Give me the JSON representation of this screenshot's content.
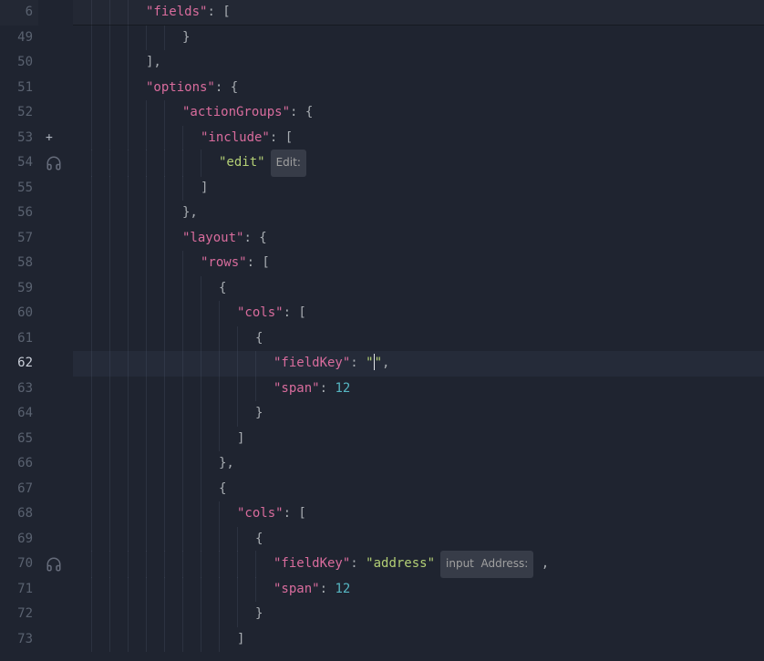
{
  "editor": {
    "sticky": {
      "lineNumber": "6",
      "indent": 4,
      "tokens": [
        {
          "t": "key",
          "v": "\"fields\""
        },
        {
          "t": "punc",
          "v": ": ["
        }
      ]
    },
    "lines": [
      {
        "n": "49",
        "indent": 6,
        "tokens": [
          {
            "t": "punc",
            "v": "}"
          }
        ]
      },
      {
        "n": "50",
        "indent": 4,
        "tokens": [
          {
            "t": "punc",
            "v": "],"
          }
        ]
      },
      {
        "n": "51",
        "indent": 4,
        "tokens": [
          {
            "t": "key",
            "v": "\"options\""
          },
          {
            "t": "punc",
            "v": ": {"
          }
        ]
      },
      {
        "n": "52",
        "indent": 6,
        "tokens": [
          {
            "t": "key",
            "v": "\"actionGroups\""
          },
          {
            "t": "punc",
            "v": ": {"
          }
        ]
      },
      {
        "n": "53",
        "indent": 7,
        "glyph": "plus",
        "tokens": [
          {
            "t": "key",
            "v": "\"include\""
          },
          {
            "t": "punc",
            "v": ": ["
          }
        ]
      },
      {
        "n": "54",
        "indent": 8,
        "glyph": "headphones",
        "tokens": [
          {
            "t": "string",
            "v": "\"edit\""
          }
        ],
        "lens": "Edit:"
      },
      {
        "n": "55",
        "indent": 7,
        "tokens": [
          {
            "t": "punc",
            "v": "]"
          }
        ]
      },
      {
        "n": "56",
        "indent": 6,
        "tokens": [
          {
            "t": "punc",
            "v": "},"
          }
        ]
      },
      {
        "n": "57",
        "indent": 6,
        "tokens": [
          {
            "t": "key",
            "v": "\"layout\""
          },
          {
            "t": "punc",
            "v": ": {"
          }
        ]
      },
      {
        "n": "58",
        "indent": 7,
        "tokens": [
          {
            "t": "key",
            "v": "\"rows\""
          },
          {
            "t": "punc",
            "v": ": ["
          }
        ]
      },
      {
        "n": "59",
        "indent": 8,
        "tokens": [
          {
            "t": "punc",
            "v": "{"
          }
        ]
      },
      {
        "n": "60",
        "indent": 9,
        "tokens": [
          {
            "t": "key",
            "v": "\"cols\""
          },
          {
            "t": "punc",
            "v": ": ["
          }
        ]
      },
      {
        "n": "61",
        "indent": 10,
        "tokens": [
          {
            "t": "punc",
            "v": "{"
          }
        ]
      },
      {
        "n": "62",
        "indent": 11,
        "active": true,
        "cursorAfter": 1,
        "tokens": [
          {
            "t": "key",
            "v": "\"fieldKey\""
          },
          {
            "t": "punc",
            "v": ": "
          },
          {
            "t": "string",
            "v": "\""
          },
          {
            "t": "string",
            "v": "\""
          },
          {
            "t": "punc",
            "v": ","
          }
        ]
      },
      {
        "n": "63",
        "indent": 11,
        "tokens": [
          {
            "t": "key",
            "v": "\"span\""
          },
          {
            "t": "punc",
            "v": ": "
          },
          {
            "t": "num",
            "v": "12"
          }
        ]
      },
      {
        "n": "64",
        "indent": 10,
        "tokens": [
          {
            "t": "punc",
            "v": "}"
          }
        ]
      },
      {
        "n": "65",
        "indent": 9,
        "tokens": [
          {
            "t": "punc",
            "v": "]"
          }
        ]
      },
      {
        "n": "66",
        "indent": 8,
        "tokens": [
          {
            "t": "punc",
            "v": "},"
          }
        ]
      },
      {
        "n": "67",
        "indent": 8,
        "tokens": [
          {
            "t": "punc",
            "v": "{"
          }
        ]
      },
      {
        "n": "68",
        "indent": 9,
        "tokens": [
          {
            "t": "key",
            "v": "\"cols\""
          },
          {
            "t": "punc",
            "v": ": ["
          }
        ]
      },
      {
        "n": "69",
        "indent": 10,
        "tokens": [
          {
            "t": "punc",
            "v": "{"
          }
        ]
      },
      {
        "n": "70",
        "indent": 11,
        "glyph": "headphones",
        "tokens": [
          {
            "t": "key",
            "v": "\"fieldKey\""
          },
          {
            "t": "punc",
            "v": ": "
          },
          {
            "t": "string",
            "v": "\"address\""
          }
        ],
        "lens": "input  Address:",
        "trailing": {
          "t": "punc",
          "v": " ,"
        }
      },
      {
        "n": "71",
        "indent": 11,
        "tokens": [
          {
            "t": "key",
            "v": "\"span\""
          },
          {
            "t": "punc",
            "v": ": "
          },
          {
            "t": "num",
            "v": "12"
          }
        ]
      },
      {
        "n": "72",
        "indent": 10,
        "tokens": [
          {
            "t": "punc",
            "v": "}"
          }
        ]
      },
      {
        "n": "73",
        "indent": 9,
        "tokens": [
          {
            "t": "punc",
            "v": "]"
          }
        ]
      }
    ],
    "indentUnit": 10,
    "baseIndentPx": 20
  },
  "icons": {
    "plus": "+",
    "headphones": "headphones"
  }
}
